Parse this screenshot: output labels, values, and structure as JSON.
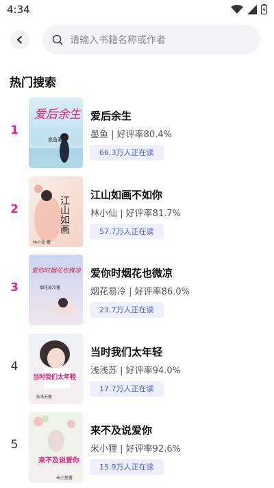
{
  "status_bar": {
    "time": "4:34"
  },
  "search": {
    "placeholder": "请输入书籍名称或作者"
  },
  "section": {
    "title": "热门搜索"
  },
  "books": [
    {
      "rank": "1",
      "title": "爱后余生",
      "author": "墨鱼",
      "rating": "好评率80.4%",
      "readers": "66.3万人正在读",
      "cover_text": "爱后余生",
      "cover_author": "墨鱼著"
    },
    {
      "rank": "2",
      "title": "江山如画不如你",
      "author": "林小仙",
      "rating": "好评率81.7%",
      "readers": "57.7万人正在读",
      "cover_text": "江山如画",
      "cover_author": "林小仙 著"
    },
    {
      "rank": "3",
      "title": "爱你时烟花也微凉",
      "author": "烟花易冷",
      "rating": "好评率86.0%",
      "readers": "23.7万人正在读",
      "cover_text": "爱你时烟花也微凉",
      "cover_author": "烟花易冷著"
    },
    {
      "rank": "4",
      "title": "当时我们太年轻",
      "author": "浅浅苏",
      "rating": "好评率94.0%",
      "readers": "17.7万人正在读",
      "cover_text": "当时我们太年轻",
      "cover_author": "浅浅苏著"
    },
    {
      "rank": "5",
      "title": "来不及说爱你",
      "author": "米小狸",
      "rating": "好评率92.6%",
      "readers": "15.9万人正在读",
      "cover_text": "来不及说爱你",
      "cover_author": "米小狸著"
    }
  ],
  "colors": {
    "hot_rank": "#e6239a",
    "badge_bg": "#eef0fe",
    "badge_text": "#4b5bd6"
  },
  "icons": {
    "back": "chevron-left-icon",
    "search": "search-icon",
    "wifi": "wifi-icon",
    "signal": "signal-icon",
    "battery": "battery-icon"
  }
}
